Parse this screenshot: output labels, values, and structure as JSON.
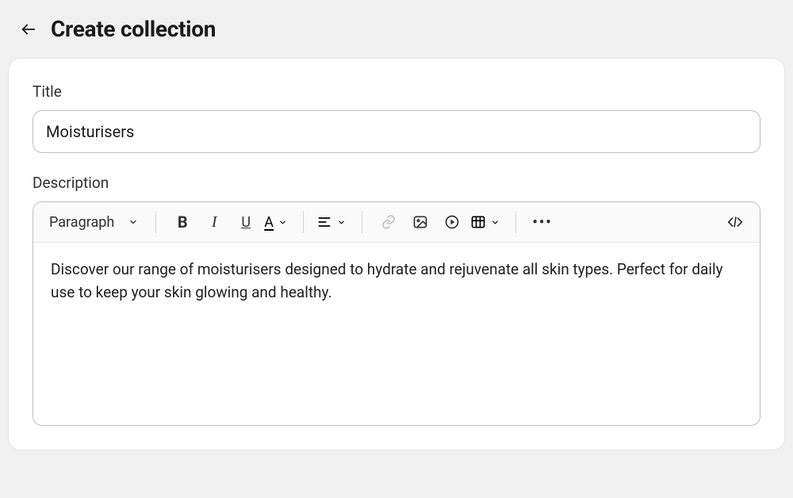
{
  "header": {
    "title": "Create collection"
  },
  "form": {
    "title_label": "Title",
    "title_value": "Moisturisers",
    "description_label": "Description"
  },
  "editor": {
    "paragraph_label": "Paragraph",
    "content": "Discover our range of moisturisers designed to hydrate and rejuvenate all skin types. Perfect for daily use to keep your skin glowing and healthy."
  }
}
